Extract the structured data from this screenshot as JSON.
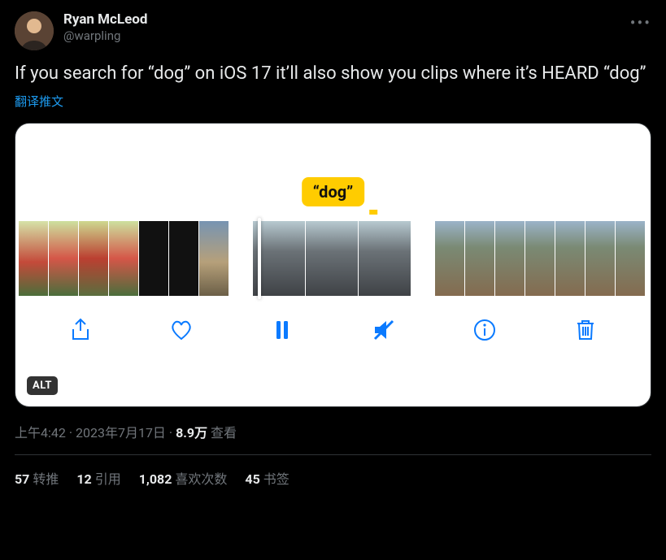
{
  "user": {
    "display_name": "Ryan McLeod",
    "handle": "@warpling"
  },
  "body": "If you search for “dog” on iOS 17 it’ll also show you clips where it’s HEARD “dog”",
  "translate": "翻译推文",
  "media": {
    "tooltip": "“dog”",
    "alt_badge": "ALT",
    "icons": {
      "share": "share-icon",
      "like": "heart-icon",
      "pause": "pause-icon",
      "mute": "mute-icon",
      "info": "info-icon",
      "delete": "trash-icon"
    }
  },
  "meta": {
    "time": "上午4:42",
    "dot1": " · ",
    "date": "2023年7月17日",
    "dot2": " · ",
    "views_count": "8.9万",
    "views_label": " 查看"
  },
  "stats": {
    "retweets": {
      "count": "57",
      "label": "转推"
    },
    "quotes": {
      "count": "12",
      "label": "引用"
    },
    "likes": {
      "count": "1,082",
      "label": "喜欢次数"
    },
    "bookmarks": {
      "count": "45",
      "label": "书签"
    }
  }
}
